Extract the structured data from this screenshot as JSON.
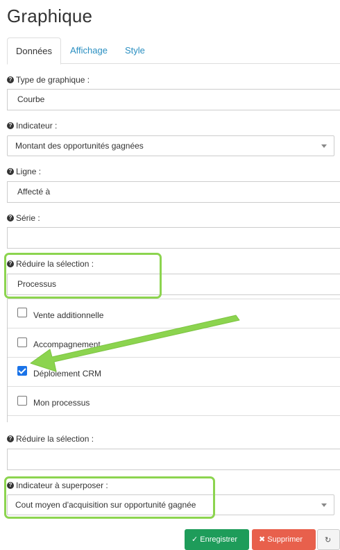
{
  "page": {
    "title": "Graphique"
  },
  "tabs": [
    {
      "label": "Données",
      "active": true
    },
    {
      "label": "Affichage",
      "active": false
    },
    {
      "label": "Style",
      "active": false
    }
  ],
  "fields": {
    "type_graphique": {
      "label": "Type de graphique :",
      "value": "Courbe"
    },
    "indicateur": {
      "label": "Indicateur :",
      "value": "Montant des opportunités gagnées"
    },
    "ligne": {
      "label": "Ligne :",
      "value": "Affecté à"
    },
    "serie": {
      "label": "Série :",
      "value": ""
    },
    "reduire_selection_1": {
      "label": "Réduire la sélection :",
      "value": "Processus"
    },
    "reduire_selection_2": {
      "label": "Réduire la sélection :",
      "value": ""
    },
    "indicateur_superposer": {
      "label": "Indicateur à superposer :",
      "value": "Cout moyen d'acquisition sur opportunité gagnée"
    }
  },
  "process_options": [
    {
      "label": "Vente additionnelle",
      "checked": false
    },
    {
      "label": "Accompagnement",
      "checked": false
    },
    {
      "label": "Déploiement CRM",
      "checked": true
    },
    {
      "label": "Mon processus",
      "checked": false
    }
  ],
  "icons": {
    "help": "question-circle-icon",
    "dropdown": "caret-down-icon",
    "annotation": "green-arrow"
  },
  "buttons": {
    "save": "Enregistrer",
    "delete": "Supprimer",
    "refresh_icon": "refresh-icon"
  },
  "colors": {
    "tab_link": "#2a8fc1",
    "highlight": "#8cd44f",
    "save_button": "#1e9c5a",
    "delete_button": "#e8604c",
    "checkbox_checked": "#1a73e8"
  }
}
